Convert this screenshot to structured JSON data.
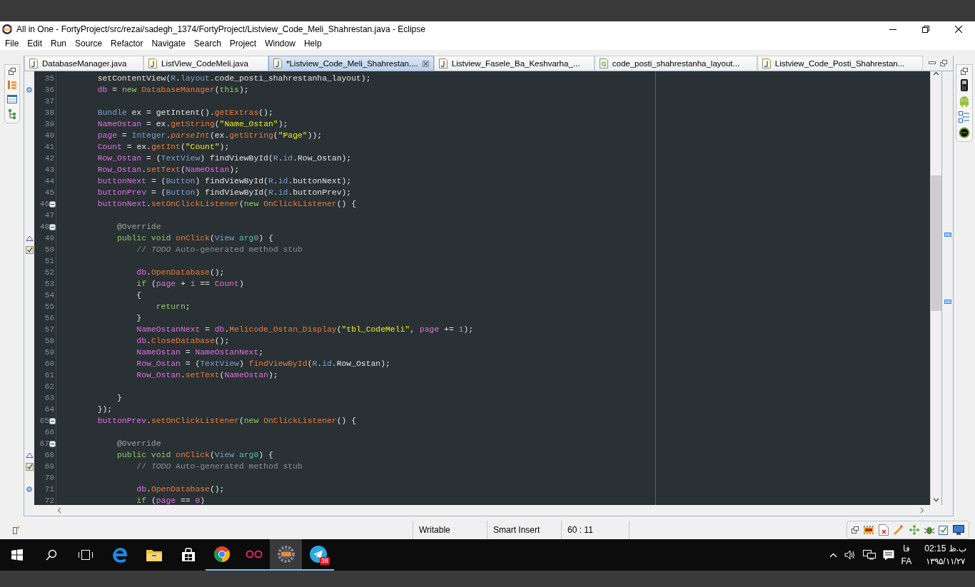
{
  "window": {
    "title": "All in One - FortyProject/src/rezai/sadegh_1374/FortyProject/Listview_Code_Meli_Shahrestan.java - Eclipse"
  },
  "menu": [
    "File",
    "Edit",
    "Run",
    "Source",
    "Refactor",
    "Navigate",
    "Search",
    "Project",
    "Window",
    "Help"
  ],
  "tabs": [
    {
      "label": "DatabaseManager.java",
      "kind": "java",
      "selected": false
    },
    {
      "label": "ListView_CodeMeli.java",
      "kind": "java",
      "selected": false
    },
    {
      "label": "*Listview_Code_Meli_Shahrestan....",
      "kind": "java",
      "selected": true
    },
    {
      "label": "Listview_Fasele_Ba_Keshvarha_...",
      "kind": "java",
      "selected": false
    },
    {
      "label": "code_posti_shahrestanha_layout...",
      "kind": "layout",
      "selected": false
    },
    {
      "label": "Listview_Code_Posti_Shahrestan...",
      "kind": "java",
      "selected": false
    }
  ],
  "editor": {
    "lines": [
      {
        "number": "35",
        "tokens": [
          {
            "kind": "p",
            "text": "        setContentView("
          },
          {
            "kind": "t",
            "text": "R"
          },
          {
            "kind": "p",
            "text": "."
          },
          {
            "kind": "t",
            "text": "layout"
          },
          {
            "kind": "p",
            "text": ".code_posti_shahrestanha_layout);"
          }
        ]
      },
      {
        "number": "36",
        "kind": "dot",
        "tokens": [
          {
            "kind": "f",
            "text": "        db"
          },
          {
            "kind": "p",
            "text": " = "
          },
          {
            "kind": "k",
            "text": "new "
          },
          {
            "kind": "m",
            "text": "DatabaseManager"
          },
          {
            "kind": "p",
            "text": "("
          },
          {
            "kind": "k",
            "text": "this"
          },
          {
            "kind": "p",
            "text": ");"
          }
        ]
      },
      {
        "number": "37"
      },
      {
        "number": "38",
        "tokens": [
          {
            "kind": "t",
            "text": "        Bundle"
          },
          {
            "kind": "p",
            "text": " ex = getIntent()."
          },
          {
            "kind": "m",
            "text": "getExtras"
          },
          {
            "kind": "p",
            "text": "();"
          }
        ]
      },
      {
        "number": "39",
        "tokens": [
          {
            "kind": "f",
            "text": "        NameOstan"
          },
          {
            "kind": "p",
            "text": " = ex."
          },
          {
            "kind": "m",
            "text": "getString"
          },
          {
            "kind": "p",
            "text": "("
          },
          {
            "kind": "s",
            "text": "\"Name_Ostan\""
          },
          {
            "kind": "p",
            "text": ");"
          }
        ]
      },
      {
        "number": "40",
        "tokens": [
          {
            "kind": "f",
            "text": "        page"
          },
          {
            "kind": "p",
            "text": " = "
          },
          {
            "kind": "t",
            "text": "Integer"
          },
          {
            "kind": "p",
            "text": "."
          },
          {
            "kind": "i",
            "text": "parseInt"
          },
          {
            "kind": "p",
            "text": "(ex."
          },
          {
            "kind": "m",
            "text": "getString"
          },
          {
            "kind": "p",
            "text": "("
          },
          {
            "kind": "s",
            "text": "\"Page\""
          },
          {
            "kind": "p",
            "text": "));"
          }
        ]
      },
      {
        "number": "41",
        "tokens": [
          {
            "kind": "f",
            "text": "        Count"
          },
          {
            "kind": "p",
            "text": " = ex."
          },
          {
            "kind": "m",
            "text": "getInt"
          },
          {
            "kind": "p",
            "text": "("
          },
          {
            "kind": "s",
            "text": "\"Count\""
          },
          {
            "kind": "p",
            "text": ");"
          }
        ]
      },
      {
        "number": "42",
        "tokens": [
          {
            "kind": "f",
            "text": "        Row_Ostan"
          },
          {
            "kind": "p",
            "text": " = ("
          },
          {
            "kind": "t",
            "text": "TextView"
          },
          {
            "kind": "p",
            "text": ") findViewById("
          },
          {
            "kind": "t",
            "text": "R"
          },
          {
            "kind": "p",
            "text": "."
          },
          {
            "kind": "t",
            "text": "id"
          },
          {
            "kind": "p",
            "text": ".Row_Ostan);"
          }
        ]
      },
      {
        "number": "43",
        "tokens": [
          {
            "kind": "f",
            "text": "        Row_Ostan"
          },
          {
            "kind": "p",
            "text": "."
          },
          {
            "kind": "m",
            "text": "setText"
          },
          {
            "kind": "p",
            "text": "("
          },
          {
            "kind": "f",
            "text": "NameOstan"
          },
          {
            "kind": "p",
            "text": ");"
          }
        ]
      },
      {
        "number": "44",
        "tokens": [
          {
            "kind": "f",
            "text": "        buttonNext"
          },
          {
            "kind": "p",
            "text": " = ("
          },
          {
            "kind": "t",
            "text": "Button"
          },
          {
            "kind": "p",
            "text": ") findViewById("
          },
          {
            "kind": "t",
            "text": "R"
          },
          {
            "kind": "p",
            "text": "."
          },
          {
            "kind": "t",
            "text": "id"
          },
          {
            "kind": "p",
            "text": ".buttonNext);"
          }
        ]
      },
      {
        "number": "45",
        "tokens": [
          {
            "kind": "f",
            "text": "        buttonPrev"
          },
          {
            "kind": "p",
            "text": " = ("
          },
          {
            "kind": "t",
            "text": "Button"
          },
          {
            "kind": "p",
            "text": ") findViewById("
          },
          {
            "kind": "t",
            "text": "R"
          },
          {
            "kind": "p",
            "text": "."
          },
          {
            "kind": "t",
            "text": "id"
          },
          {
            "kind": "p",
            "text": ".buttonPrev);"
          }
        ]
      },
      {
        "number": "46",
        "kind": "fold",
        "tokens": [
          {
            "kind": "f",
            "text": "        buttonNext"
          },
          {
            "kind": "p",
            "text": "."
          },
          {
            "kind": "m",
            "text": "setOnClickListener"
          },
          {
            "kind": "p",
            "text": "("
          },
          {
            "kind": "k",
            "text": "new "
          },
          {
            "kind": "m",
            "text": "OnClickListener"
          },
          {
            "kind": "p",
            "text": "() {"
          }
        ]
      },
      {
        "number": "47"
      },
      {
        "number": "48",
        "kind": "fold",
        "tokens": [
          {
            "kind": "a",
            "text": "            @Override"
          }
        ]
      },
      {
        "number": "49",
        "kind": "override",
        "tokens": [
          {
            "kind": "k",
            "text": "            public void "
          },
          {
            "kind": "m",
            "text": "onClick"
          },
          {
            "kind": "p",
            "text": "("
          },
          {
            "kind": "t",
            "text": "View "
          },
          {
            "kind": "v",
            "text": "arg0"
          },
          {
            "kind": "p",
            "text": ") {"
          }
        ]
      },
      {
        "number": "50",
        "kind": "task",
        "tokens": [
          {
            "kind": "c",
            "text": "                // "
          },
          {
            "kind": "ci",
            "text": "TODO"
          },
          {
            "kind": "c",
            "text": " Auto-generated method stub"
          }
        ]
      },
      {
        "number": "51"
      },
      {
        "number": "52",
        "tokens": [
          {
            "kind": "f",
            "text": "                db"
          },
          {
            "kind": "p",
            "text": "."
          },
          {
            "kind": "m",
            "text": "OpenDatabase"
          },
          {
            "kind": "p",
            "text": "();"
          }
        ]
      },
      {
        "number": "53",
        "tokens": [
          {
            "kind": "k",
            "text": "                if"
          },
          {
            "kind": "p",
            "text": " ("
          },
          {
            "kind": "f",
            "text": "page"
          },
          {
            "kind": "p",
            "text": " + "
          },
          {
            "kind": "n",
            "text": "1"
          },
          {
            "kind": "p",
            "text": " == "
          },
          {
            "kind": "f",
            "text": "Count"
          },
          {
            "kind": "p",
            "text": ")"
          }
        ]
      },
      {
        "number": "54",
        "tokens": [
          {
            "kind": "p",
            "text": "                {"
          }
        ]
      },
      {
        "number": "55",
        "tokens": [
          {
            "kind": "k",
            "text": "                    return"
          },
          {
            "kind": "p",
            "text": ";"
          }
        ]
      },
      {
        "number": "56",
        "tokens": [
          {
            "kind": "p",
            "text": "                }"
          }
        ]
      },
      {
        "number": "57",
        "tokens": [
          {
            "kind": "f",
            "text": "                NameOstanNext"
          },
          {
            "kind": "p",
            "text": " = "
          },
          {
            "kind": "f",
            "text": "db"
          },
          {
            "kind": "p",
            "text": "."
          },
          {
            "kind": "m",
            "text": "Melicode_Ostan_Display"
          },
          {
            "kind": "p",
            "text": "("
          },
          {
            "kind": "s",
            "text": "\"tbl_CodeMeli\""
          },
          {
            "kind": "p",
            "text": ", "
          },
          {
            "kind": "f",
            "text": "page"
          },
          {
            "kind": "p",
            "text": " += "
          },
          {
            "kind": "n",
            "text": "1"
          },
          {
            "kind": "p",
            "text": ");"
          }
        ]
      },
      {
        "number": "58",
        "tokens": [
          {
            "kind": "f",
            "text": "                db"
          },
          {
            "kind": "p",
            "text": "."
          },
          {
            "kind": "m",
            "text": "CloseDatabase"
          },
          {
            "kind": "p",
            "text": "();"
          }
        ]
      },
      {
        "number": "59",
        "tokens": [
          {
            "kind": "f",
            "text": "                NameOstan"
          },
          {
            "kind": "p",
            "text": " = "
          },
          {
            "kind": "f",
            "text": "NameOstanNext"
          },
          {
            "kind": "p",
            "text": ";"
          }
        ]
      },
      {
        "number": "60",
        "tokens": [
          {
            "kind": "f",
            "text": "                Row_Ostan"
          },
          {
            "kind": "p",
            "text": " = ("
          },
          {
            "kind": "t",
            "text": "TextView"
          },
          {
            "kind": "p",
            "text": ") "
          },
          {
            "kind": "m",
            "text": "findViewById"
          },
          {
            "kind": "p",
            "text": "("
          },
          {
            "kind": "t",
            "text": "R"
          },
          {
            "kind": "p",
            "text": "."
          },
          {
            "kind": "t",
            "text": "id"
          },
          {
            "kind": "p",
            "text": ".Row_Ostan);"
          }
        ]
      },
      {
        "number": "61",
        "tokens": [
          {
            "kind": "f",
            "text": "                Row_Ostan"
          },
          {
            "kind": "p",
            "text": "."
          },
          {
            "kind": "m",
            "text": "setText"
          },
          {
            "kind": "p",
            "text": "("
          },
          {
            "kind": "f",
            "text": "NameOstan"
          },
          {
            "kind": "p",
            "text": ");"
          }
        ]
      },
      {
        "number": "62"
      },
      {
        "number": "63",
        "tokens": [
          {
            "kind": "p",
            "text": "            }"
          }
        ]
      },
      {
        "number": "64",
        "tokens": [
          {
            "kind": "p",
            "text": "        });"
          }
        ]
      },
      {
        "number": "65",
        "kind": "fold",
        "tokens": [
          {
            "kind": "f",
            "text": "        buttonPrev"
          },
          {
            "kind": "p",
            "text": "."
          },
          {
            "kind": "m",
            "text": "setOnClickListener"
          },
          {
            "kind": "p",
            "text": "("
          },
          {
            "kind": "k",
            "text": "new "
          },
          {
            "kind": "m",
            "text": "OnClickListener"
          },
          {
            "kind": "p",
            "text": "() {"
          }
        ]
      },
      {
        "number": "66"
      },
      {
        "number": "67",
        "kind": "fold",
        "tokens": [
          {
            "kind": "a",
            "text": "            @Override"
          }
        ]
      },
      {
        "number": "68",
        "kind": "override",
        "tokens": [
          {
            "kind": "k",
            "text": "            public void "
          },
          {
            "kind": "m",
            "text": "onClick"
          },
          {
            "kind": "p",
            "text": "("
          },
          {
            "kind": "t",
            "text": "View "
          },
          {
            "kind": "v",
            "text": "arg0"
          },
          {
            "kind": "p",
            "text": ") {"
          }
        ]
      },
      {
        "number": "69",
        "kind": "task",
        "tokens": [
          {
            "kind": "c",
            "text": "                // "
          },
          {
            "kind": "ci",
            "text": "TODO"
          },
          {
            "kind": "c",
            "text": " Auto-generated method stub"
          }
        ]
      },
      {
        "number": "70"
      },
      {
        "number": "71",
        "kind": "dot",
        "tokens": [
          {
            "kind": "f",
            "text": "                db"
          },
          {
            "kind": "p",
            "text": "."
          },
          {
            "kind": "m",
            "text": "OpenDatabase"
          },
          {
            "kind": "p",
            "text": "();"
          }
        ]
      },
      {
        "number": "72",
        "tokens": [
          {
            "kind": "k",
            "text": "                if"
          },
          {
            "kind": "p",
            "text": " ("
          },
          {
            "kind": "f",
            "text": "page"
          },
          {
            "kind": "p",
            "text": " == "
          },
          {
            "kind": "n",
            "text": "0"
          },
          {
            "kind": "p",
            "text": ")"
          }
        ]
      }
    ]
  },
  "status_bar": {
    "fields": [
      "Writable",
      "Smart Insert",
      "60 : 11"
    ]
  },
  "taskbar": {
    "apps": [
      {
        "kind": "browser-e",
        "running": false,
        "selected": false
      },
      {
        "kind": "folder",
        "running": false,
        "selected": false
      },
      {
        "kind": "store",
        "running": false,
        "selected": false
      },
      {
        "kind": "chrome",
        "running": true,
        "selected": false
      },
      {
        "kind": "rings",
        "running": true,
        "selected": false
      },
      {
        "kind": "gear",
        "running": true,
        "selected": true
      },
      {
        "kind": "telegram",
        "running": true,
        "selected": false,
        "badge": "38"
      }
    ],
    "language_native": "فا",
    "language": "FA",
    "time": "02:15 ب.ظ",
    "date": "۱۳۹۵/۱۱/۲۷"
  }
}
